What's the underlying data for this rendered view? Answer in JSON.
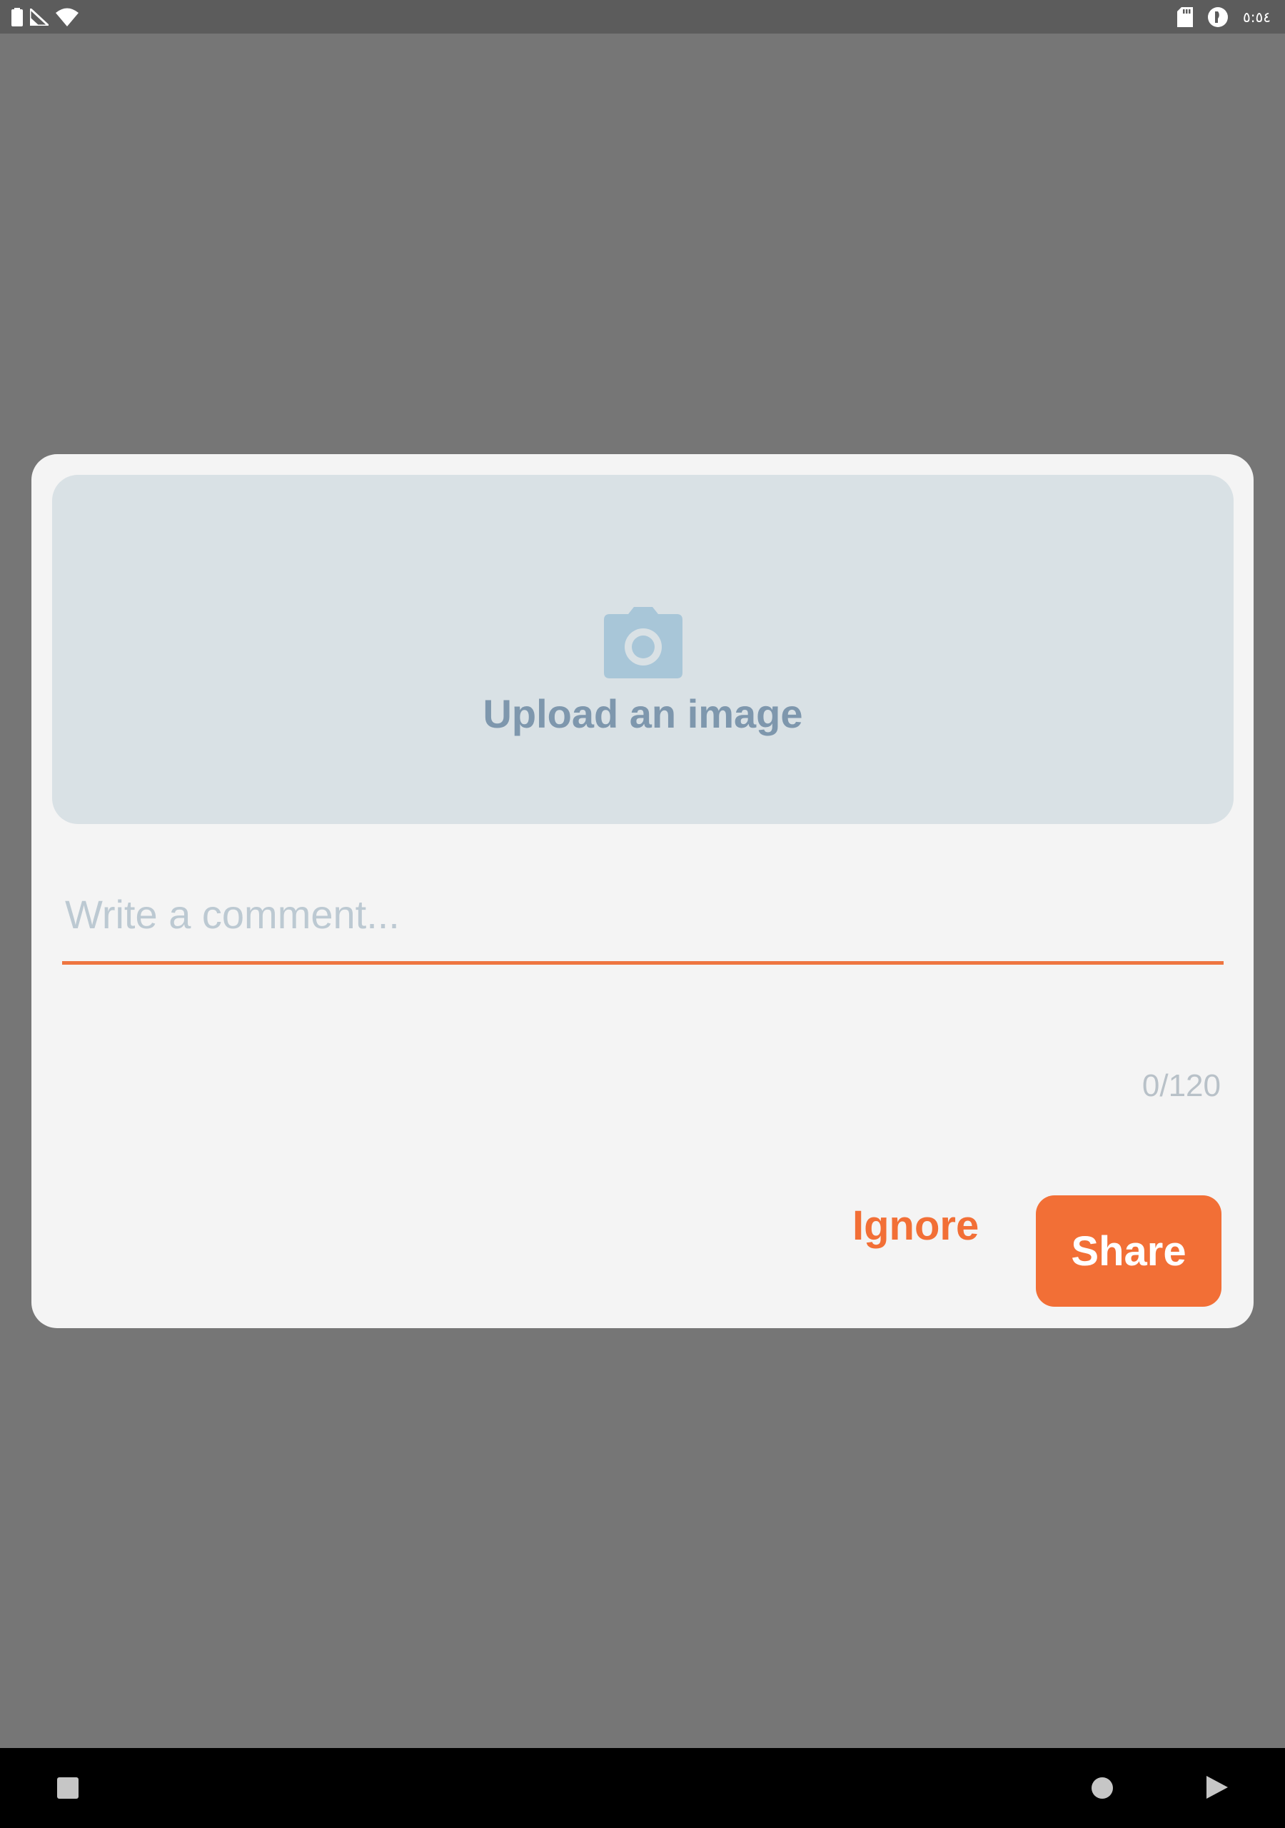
{
  "status_bar": {
    "time": "٥:٥٤",
    "icons": [
      "battery-icon",
      "signal-icon",
      "wifi-icon",
      "sd-card-icon",
      "data-saver-icon"
    ]
  },
  "dialog": {
    "upload": {
      "icon": "camera-icon",
      "label": "Upload an image"
    },
    "comment": {
      "placeholder": "Write a comment...",
      "value": "",
      "counter": "0/120"
    },
    "actions": {
      "ignore_label": "Ignore",
      "share_label": "Share"
    }
  },
  "nav_bar": {
    "icons": [
      "recents-icon",
      "home-icon",
      "back-icon"
    ]
  },
  "colors": {
    "accent": "#f26f36",
    "scrim": "#767676",
    "dialog_bg": "#f4f4f4",
    "upload_bg": "#d9e1e5",
    "upload_text": "#7e97ad"
  }
}
